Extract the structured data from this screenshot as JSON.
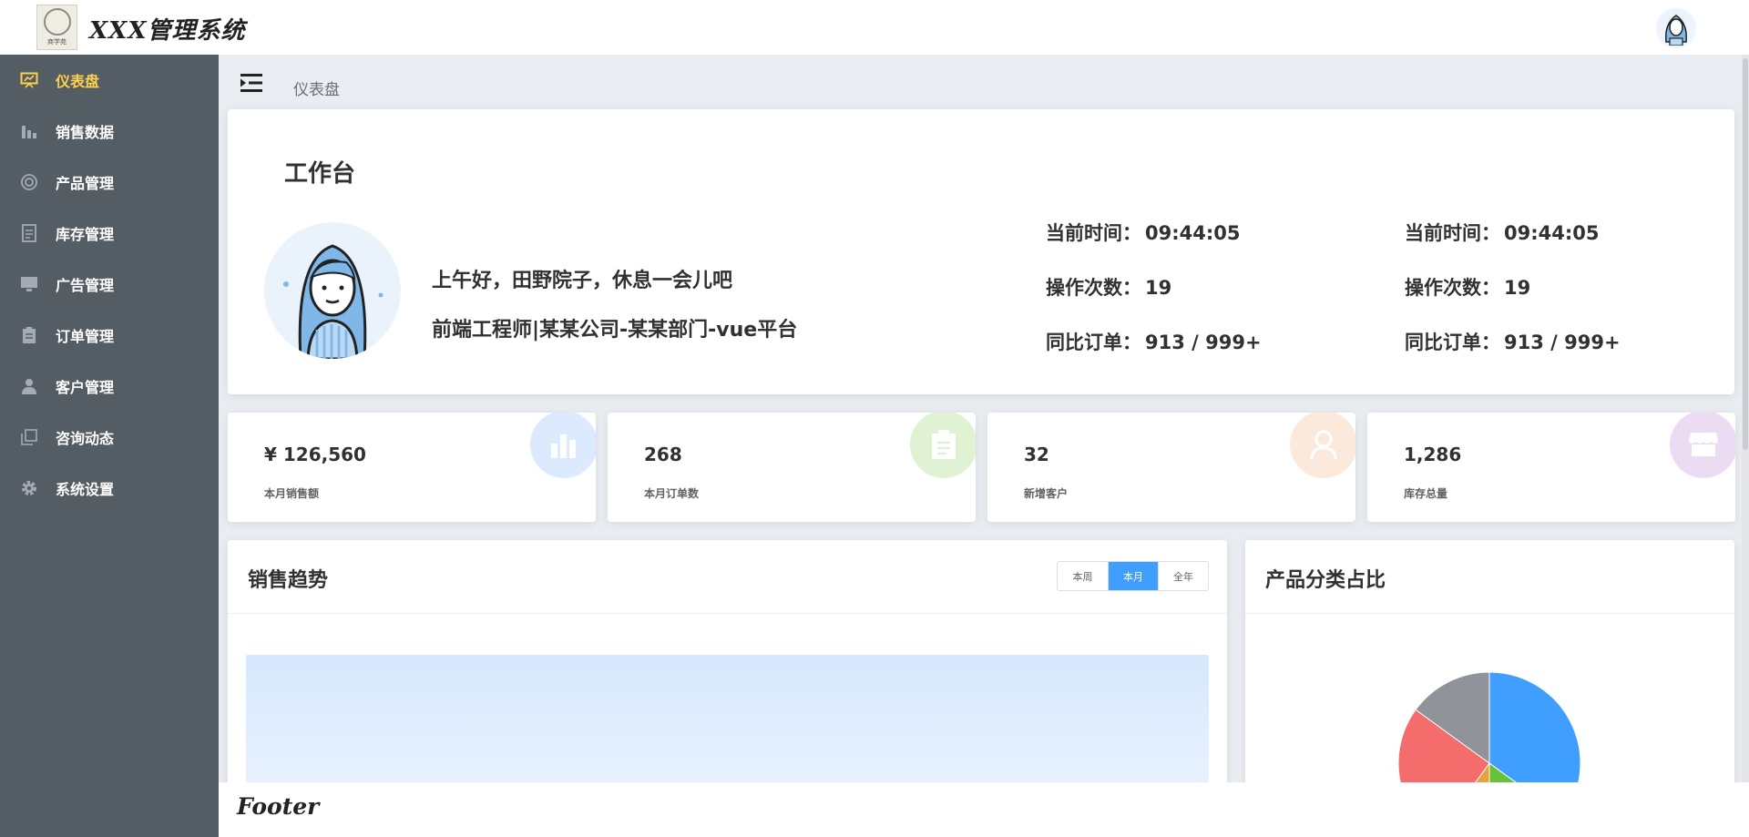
{
  "header": {
    "app_title": "XXX管理系统",
    "logo_text": "商学苑"
  },
  "sidebar": {
    "items": [
      {
        "label": "仪表盘",
        "icon": "dashboard-icon",
        "active": true
      },
      {
        "label": "销售数据",
        "icon": "bar-chart-icon"
      },
      {
        "label": "产品管理",
        "icon": "product-ring-icon"
      },
      {
        "label": "库存管理",
        "icon": "document-icon"
      },
      {
        "label": "广告管理",
        "icon": "monitor-icon"
      },
      {
        "label": "订单管理",
        "icon": "clipboard-icon"
      },
      {
        "label": "客户管理",
        "icon": "user-icon"
      },
      {
        "label": "咨询动态",
        "icon": "copy-icon"
      },
      {
        "label": "系统设置",
        "icon": "gear-icon"
      }
    ]
  },
  "breadcrumb": {
    "current": "仪表盘"
  },
  "welcome": {
    "title": "工作台",
    "greeting": "上午好，田野院子，休息一会儿吧",
    "role": "前端工程师|某某公司-某某部门-vue平台",
    "stats_left": {
      "time_label": "当前时间：",
      "time_value": "09:44:05",
      "ops_label": "操作次数：",
      "ops_value": "19",
      "orders_label": "同比订单：",
      "orders_value": "913 / 999+"
    },
    "stats_right": {
      "time_label": "当前时间：",
      "time_value": "09:44:05",
      "ops_label": "操作次数：",
      "ops_value": "19",
      "orders_label": "同比订单：",
      "orders_value": "913 / 999+"
    }
  },
  "kpis": [
    {
      "value": "¥ 126,560",
      "label": "本月销售额",
      "icon": "bar-chart-icon",
      "color": "#409eff"
    },
    {
      "value": "268",
      "label": "本月订单数",
      "icon": "clipboard-icon",
      "color": "#67c23a"
    },
    {
      "value": "32",
      "label": "新增客户",
      "icon": "user-icon",
      "color": "#e6a23c"
    },
    {
      "value": "1,286",
      "label": "库存总量",
      "icon": "store-icon",
      "color": "#a77ccf"
    }
  ],
  "sales_panel": {
    "title": "销售趋势",
    "tabs": [
      {
        "label": "本周"
      },
      {
        "label": "本月",
        "active": true
      },
      {
        "label": "全年"
      }
    ]
  },
  "pie_panel": {
    "title": "产品分类占比"
  },
  "chart_data": {
    "type": "pie",
    "title": "产品分类占比",
    "slices": [
      {
        "value": 35,
        "color": "#409eff"
      },
      {
        "value": 15,
        "color": "#67c23a"
      },
      {
        "value": 10,
        "color": "#e6a23c"
      },
      {
        "value": 25,
        "color": "#f56c6c"
      },
      {
        "value": 15,
        "color": "#909399"
      }
    ]
  },
  "footer": {
    "text": "Footer"
  },
  "colors": {
    "sidebar_bg": "#545c64",
    "active_menu": "#ffd04b",
    "primary": "#409eff"
  }
}
